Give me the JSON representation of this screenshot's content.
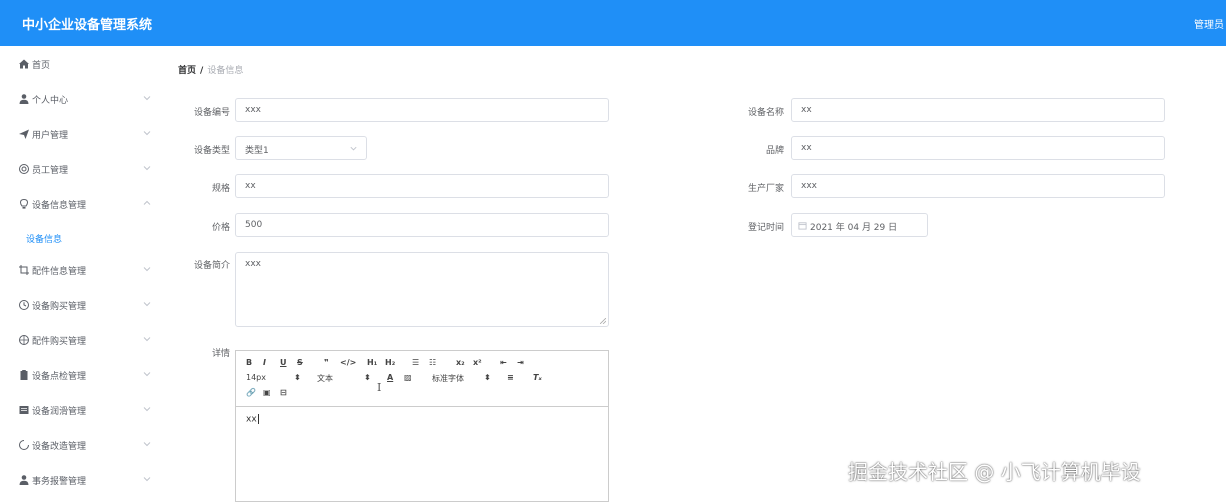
{
  "header": {
    "title": "中小企业设备管理系统",
    "user": "管理员"
  },
  "sidebar": {
    "items": [
      {
        "label": "首页",
        "icon": "home-icon"
      },
      {
        "label": "个人中心",
        "icon": "user-icon"
      },
      {
        "label": "用户管理",
        "icon": "send-icon"
      },
      {
        "label": "员工管理",
        "icon": "support-icon"
      },
      {
        "label": "设备信息管理",
        "icon": "bulb-icon"
      },
      {
        "label": "配件信息管理",
        "icon": "crop-icon"
      },
      {
        "label": "设备购买管理",
        "icon": "clock-icon"
      },
      {
        "label": "配件购买管理",
        "icon": "basketball-icon"
      },
      {
        "label": "设备点检管理",
        "icon": "clipboard-icon"
      },
      {
        "label": "设备润滑管理",
        "icon": "document-icon"
      },
      {
        "label": "设备改造管理",
        "icon": "loading-circle-icon"
      },
      {
        "label": "事务报警管理",
        "icon": "user-icon"
      }
    ],
    "active_sub": "设备信息"
  },
  "breadcrumb": {
    "home": "首页",
    "separator": "/",
    "current": "设备信息"
  },
  "form": {
    "code": {
      "label": "设备编号",
      "value": "xxx"
    },
    "name": {
      "label": "设备名称",
      "value": "xx"
    },
    "type": {
      "label": "设备类型",
      "value": "类型1"
    },
    "brand": {
      "label": "品牌",
      "value": "xx"
    },
    "spec": {
      "label": "规格",
      "value": "xx"
    },
    "maker": {
      "label": "生产厂家",
      "value": "xxx"
    },
    "price": {
      "label": "价格",
      "value": "500"
    },
    "date": {
      "label": "登记时间",
      "value": "2021 年 04 月 29 日"
    },
    "intro": {
      "label": "设备简介",
      "value": "xxx"
    },
    "detail": {
      "label": "详情",
      "value": "xx"
    }
  },
  "editor": {
    "font_size": "14px",
    "block_format": "文本",
    "font_family": "标准字体"
  },
  "watermark": "掘金技术社区 @ 小飞计算机毕设"
}
